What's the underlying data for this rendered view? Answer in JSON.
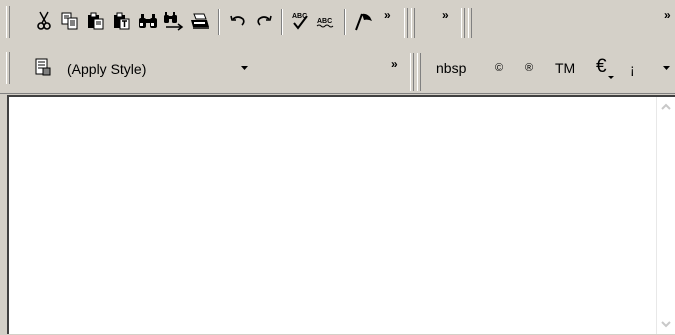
{
  "toolbar1": {
    "buttons": [
      {
        "name": "cut-icon"
      },
      {
        "name": "copy-icon"
      },
      {
        "name": "paste-icon"
      },
      {
        "name": "paste-text-icon"
      },
      {
        "name": "find-icon"
      },
      {
        "name": "find-next-icon"
      },
      {
        "name": "print-icon"
      },
      {
        "name": "undo-icon"
      },
      {
        "name": "redo-icon"
      },
      {
        "name": "spellcheck-icon"
      },
      {
        "name": "spellcheck-text-icon"
      },
      {
        "name": "flag-icon"
      }
    ],
    "spellcheck_label": "ABC",
    "overflow_label": "»"
  },
  "toolbar2": {
    "style_dropdown": {
      "value": "(Apply Style)"
    },
    "overflow_label": "»",
    "entities": {
      "nbsp": "nbsp",
      "copyright": "©",
      "registered": "®",
      "trademark": "TM",
      "euro": "€"
    },
    "char_dropdown": {
      "value": "¡"
    }
  },
  "colors": {
    "face": "#d4d0c8",
    "shadow": "#808080",
    "highlight": "#ffffff",
    "editor_bg": "#ffffff"
  }
}
